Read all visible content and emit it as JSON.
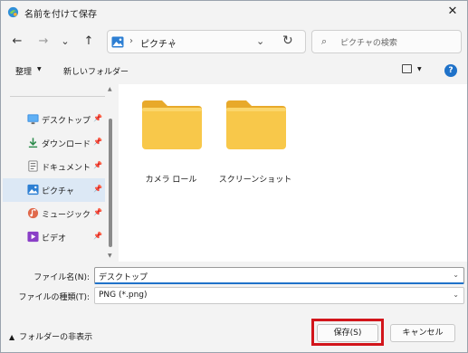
{
  "window": {
    "title": "名前を付けて保存",
    "close_symbol": "✕"
  },
  "nav": {
    "back_symbol": "←",
    "forward_symbol": "→",
    "recent_symbol": "⌄",
    "up_symbol": "↑",
    "address_sep": "›",
    "address_location": "ピクチャ",
    "address_dropdown": "⌄",
    "refresh_symbol": "↻",
    "search_placeholder": "ピクチャの検索",
    "search_symbol": "⌕"
  },
  "commands": {
    "organize": "整理",
    "dropdown_arrow": "▼",
    "new_folder": "新しいフォルダー",
    "help": "?"
  },
  "sidebar": {
    "pin_symbol": "📌",
    "items": [
      {
        "label": "デスクトップ",
        "icon": "desktop-icon",
        "selected": false
      },
      {
        "label": "ダウンロード",
        "icon": "download-icon",
        "selected": false
      },
      {
        "label": "ドキュメント",
        "icon": "document-icon",
        "selected": false
      },
      {
        "label": "ピクチャ",
        "icon": "picture-icon",
        "selected": true
      },
      {
        "label": "ミュージック",
        "icon": "music-icon",
        "selected": false
      },
      {
        "label": "ビデオ",
        "icon": "video-icon",
        "selected": false
      }
    ],
    "scroll_up": "▲",
    "scroll_down": "▼"
  },
  "folders": [
    {
      "label": "カメラ ロール"
    },
    {
      "label": "スクリーンショット"
    }
  ],
  "form": {
    "filename_label": "ファイル名(N):",
    "filename_value": "デスクトップ",
    "filetype_label": "ファイルの種類(T):",
    "filetype_value": "PNG (*.png)",
    "arrow": "⌄"
  },
  "footer": {
    "hide_folders": "フォルダーの非表示",
    "hide_arrow": "▲",
    "save": "保存(S)",
    "cancel": "キャンセル"
  },
  "colors": {
    "accent": "#1f72c9",
    "highlight_border": "#d2151b",
    "folder_yellow": "#f8c84a",
    "selected_row": "#dce8f5"
  }
}
